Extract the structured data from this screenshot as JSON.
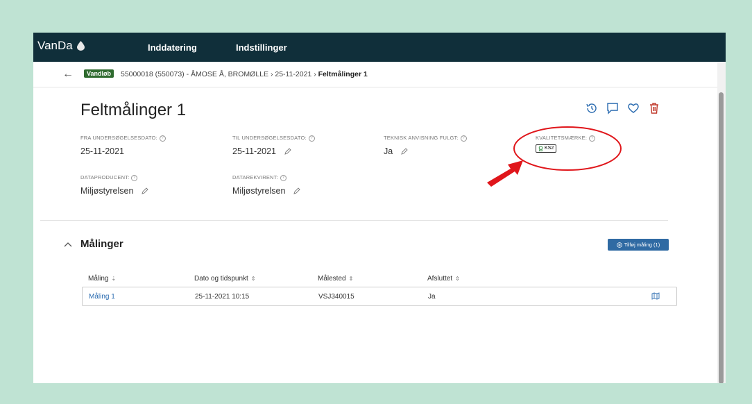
{
  "app": {
    "name": "VanDa"
  },
  "nav": {
    "items": [
      "Inddatering",
      "Indstillinger"
    ]
  },
  "breadcrumb": {
    "tag": "Vandløb",
    "path": "55000018 (550073) - ÅMOSE Å, BROMØLLE  ›  25-11-2021  ›",
    "current": "Feltmålinger 1"
  },
  "page": {
    "title": "Feltmålinger 1"
  },
  "fields": {
    "fra": {
      "label": "FRA UNDERSØGELSESDATO:",
      "value": "25-11-2021"
    },
    "til": {
      "label": "TIL UNDERSØGELSESDATO:",
      "value": "25-11-2021"
    },
    "teknisk": {
      "label": "TEKNISK ANVISNING FULGT:",
      "value": "Ja"
    },
    "kvalitet": {
      "label": "KVALITETSMÆRKE:",
      "value": "KS2"
    },
    "dataproducent": {
      "label": "DATAPRODUCENT:",
      "value": "Miljøstyrelsen"
    },
    "datarekvirent": {
      "label": "DATAREKVIRENT:",
      "value": "Miljøstyrelsen"
    }
  },
  "section": {
    "title": "Målinger",
    "add_button": "Tilføj måling (1)"
  },
  "table": {
    "columns": [
      "Måling",
      "Dato og tidspunkt",
      "Målested",
      "Afsluttet"
    ],
    "rows": [
      {
        "maaling": "Måling 1",
        "dato": "25-11-2021 10:15",
        "maalested": "VSJ340015",
        "afsluttet": "Ja"
      }
    ]
  },
  "colors": {
    "background": "#bfe3d3",
    "topnav": "#102f3a",
    "tag": "#2f6b2f",
    "primary_button": "#2f6aa3",
    "annotation": "#e0161b",
    "delete_icon": "#c0392b",
    "link": "#2a6bb0"
  },
  "icons": [
    "water-drop-icon",
    "back-arrow-icon",
    "history-icon",
    "comment-icon",
    "heart-icon",
    "trash-icon",
    "help-icon",
    "pencil-icon",
    "award-icon",
    "chevron-up-icon",
    "plus-circle-icon",
    "sort-icon",
    "map-icon"
  ]
}
